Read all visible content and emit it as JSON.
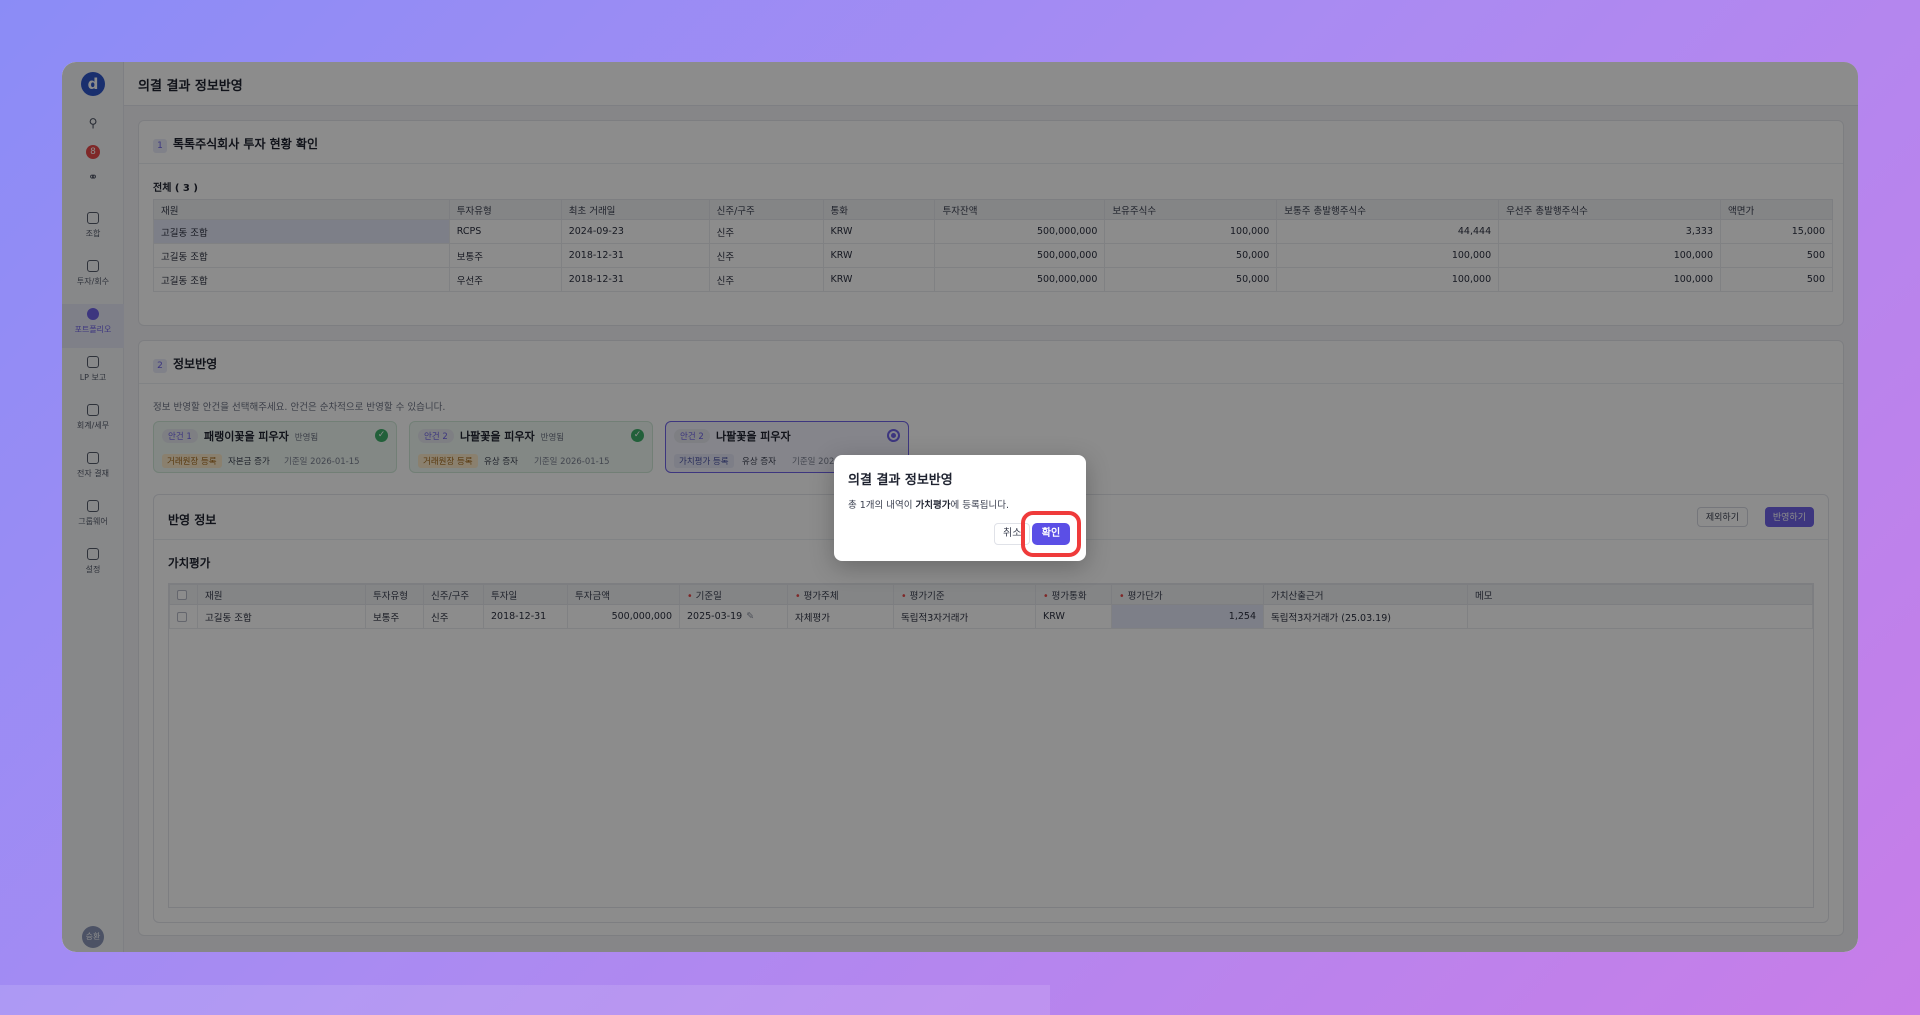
{
  "app": {
    "logo_text": "d",
    "page_title": "의결 결과 정보반영",
    "notification_count": "8",
    "avatar_text": "승환"
  },
  "sidebar": {
    "items": [
      {
        "label": "조합",
        "icon": "building-icon"
      },
      {
        "label": "투자/회수",
        "icon": "exchange-icon"
      },
      {
        "label": "포트폴리오",
        "icon": "pie-chart-icon",
        "active": true
      },
      {
        "label": "LP 보고",
        "icon": "document-icon"
      },
      {
        "label": "회계/세무",
        "icon": "ledger-icon"
      },
      {
        "label": "전자 결재",
        "icon": "approval-icon"
      },
      {
        "label": "그룹웨어",
        "icon": "people-icon"
      },
      {
        "label": "설정",
        "icon": "gear-icon"
      }
    ]
  },
  "section1": {
    "number": "1",
    "title": "톡톡주식회사 투자 현황 확인",
    "total_label": "전체 ( 3 )",
    "columns": [
      "재원",
      "투자유형",
      "최초 거래일",
      "신주/구주",
      "통화",
      "투자잔액",
      "보유주식수",
      "보통주 총발행주식수",
      "우선주 총발행주식수",
      "액면가"
    ],
    "rows": [
      [
        "고길동 조합",
        "RCPS",
        "2024-09-23",
        "신주",
        "KRW",
        "500,000,000",
        "100,000",
        "44,444",
        "3,333",
        "15,000"
      ],
      [
        "고길동 조합",
        "보통주",
        "2018-12-31",
        "신주",
        "KRW",
        "500,000,000",
        "50,000",
        "100,000",
        "100,000",
        "500"
      ],
      [
        "고길동 조합",
        "우선주",
        "2018-12-31",
        "신주",
        "KRW",
        "500,000,000",
        "50,000",
        "100,000",
        "100,000",
        "500"
      ]
    ]
  },
  "section2": {
    "number": "2",
    "title": "정보반영",
    "hint": "정보 반영할 안건을 선택해주세요. 안건은 순차적으로 반영할 수 있습니다.",
    "cases": [
      {
        "tag": "안건 1",
        "title": "패랭이꽃을 피우자",
        "status": "반영됨",
        "badge": "거래원장 등록",
        "extra": "자본금 증가",
        "date": "기준일 2026-01-15"
      },
      {
        "tag": "안건 2",
        "title": "나팔꽃을 피우자",
        "status": "반영됨",
        "badge": "거래원장 등록",
        "extra": "유상 증자",
        "date": "기준일 2026-01-15"
      },
      {
        "tag": "안건 2",
        "title": "나팔꽃을 피우자",
        "status": "",
        "badge": "가치평가 등록",
        "extra": "유상 증자",
        "date": "기준일 2026"
      }
    ]
  },
  "reflection": {
    "title": "반영 정보",
    "exclude_label": "제외하기",
    "apply_label": "반영하기",
    "valuation_title": "가치평가",
    "columns": [
      "재원",
      "투자유형",
      "신주/구주",
      "투자일",
      "투자금액",
      "기준일",
      "평가주체",
      "평가기준",
      "평가통화",
      "평가단가",
      "가치산출근거",
      "메모"
    ],
    "rows": [
      [
        "고길동 조합",
        "보통주",
        "신주",
        "2018-12-31",
        "500,000,000",
        "2025-03-19",
        "자체평가",
        "독립적3자거래가",
        "KRW",
        "1,254",
        "독립적3자거래가 (25.03.19)",
        ""
      ]
    ]
  },
  "modal": {
    "title": "의결 결과 정보반영",
    "msg_prefix": "총 1개의 내역이 ",
    "msg_bold": "가치평가",
    "msg_suffix": "에 등록됩니다.",
    "cancel_label": "취소",
    "confirm_label": "확인"
  }
}
